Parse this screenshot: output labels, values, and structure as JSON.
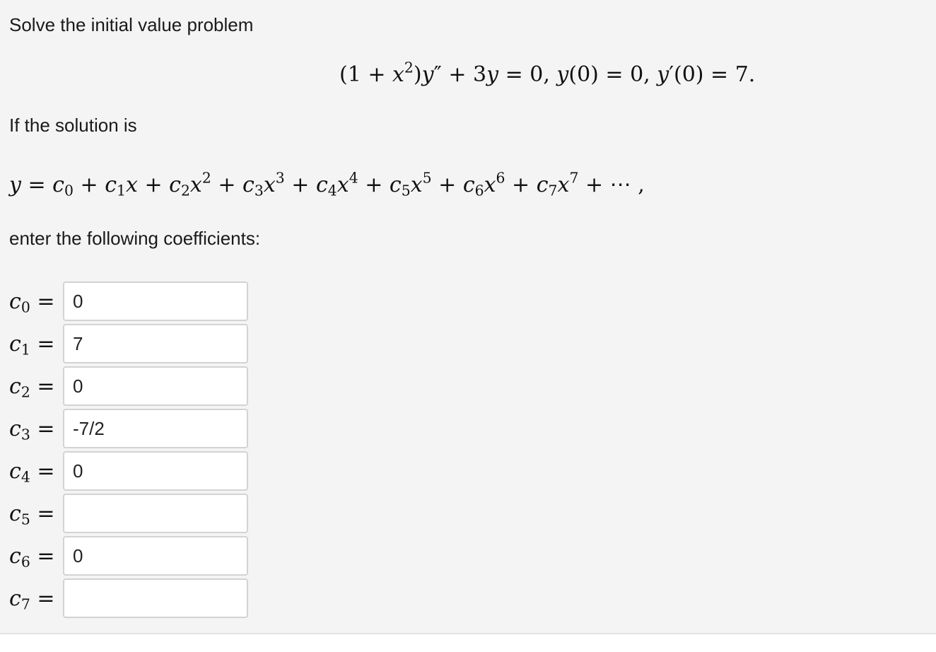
{
  "intro_text": "Solve the initial value problem",
  "ode": {
    "lhs_open": "(1 + ",
    "var_x": "x",
    "exp_2": "2",
    "close": ")",
    "var_y": "y",
    "y_double_prime_mark": "″",
    "plus_3": " + 3",
    "eq_zero": " = 0, ",
    "ic1_fn": "y",
    "ic1_rest": "(0) = 0, ",
    "ic2_fn": "y",
    "ic2_prime_mark": "′",
    "ic2_rest": "(0) = 7."
  },
  "solution_intro": "If the solution is",
  "series": {
    "y": "y",
    "eq": " = ",
    "c": "c",
    "x": "x",
    "plus": " + ",
    "ellipsis": "⋯",
    "trailing_comma": " ,",
    "terms": [
      {
        "sub": "0"
      },
      {
        "sub": "1",
        "pow": ""
      },
      {
        "sub": "2",
        "pow": "2"
      },
      {
        "sub": "3",
        "pow": "3"
      },
      {
        "sub": "4",
        "pow": "4"
      },
      {
        "sub": "5",
        "pow": "5"
      },
      {
        "sub": "6",
        "pow": "6"
      },
      {
        "sub": "7",
        "pow": "7"
      }
    ]
  },
  "instruction": "enter the following coefficients:",
  "coefficients": [
    {
      "letter": "c",
      "sub": "0",
      "eq": " =",
      "value": "0"
    },
    {
      "letter": "c",
      "sub": "1",
      "eq": " =",
      "value": "7"
    },
    {
      "letter": "c",
      "sub": "2",
      "eq": " =",
      "value": "0"
    },
    {
      "letter": "c",
      "sub": "3",
      "eq": " =",
      "value": "-7/2"
    },
    {
      "letter": "c",
      "sub": "4",
      "eq": " =",
      "value": "0"
    },
    {
      "letter": "c",
      "sub": "5",
      "eq": " =",
      "value": ""
    },
    {
      "letter": "c",
      "sub": "6",
      "eq": " =",
      "value": "0"
    },
    {
      "letter": "c",
      "sub": "7",
      "eq": " =",
      "value": ""
    }
  ]
}
